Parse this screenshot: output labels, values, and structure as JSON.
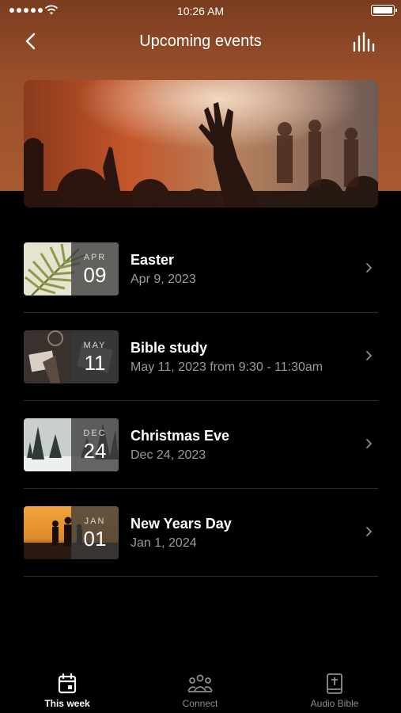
{
  "status_bar": {
    "time": "10:26 AM"
  },
  "nav": {
    "title": "Upcoming events"
  },
  "events": [
    {
      "month": "APR",
      "day": "09",
      "title": "Easter",
      "subtitle": "Apr 9, 2023"
    },
    {
      "month": "MAY",
      "day": "11",
      "title": "Bible study",
      "subtitle": "May 11, 2023 from 9:30 - 11:30am"
    },
    {
      "month": "DEC",
      "day": "24",
      "title": "Christmas Eve",
      "subtitle": "Dec 24, 2023"
    },
    {
      "month": "JAN",
      "day": "01",
      "title": "New Years Day",
      "subtitle": "Jan 1, 2024"
    }
  ],
  "tabs": [
    {
      "label": "This week",
      "icon": "calendar-icon",
      "active": true
    },
    {
      "label": "Connect",
      "icon": "people-icon",
      "active": false
    },
    {
      "label": "Audio Bible",
      "icon": "bible-icon",
      "active": false
    }
  ],
  "colors": {
    "accent_bg": "#9a4f2a",
    "background": "#000000",
    "secondary_text": "#9a9a9f"
  }
}
